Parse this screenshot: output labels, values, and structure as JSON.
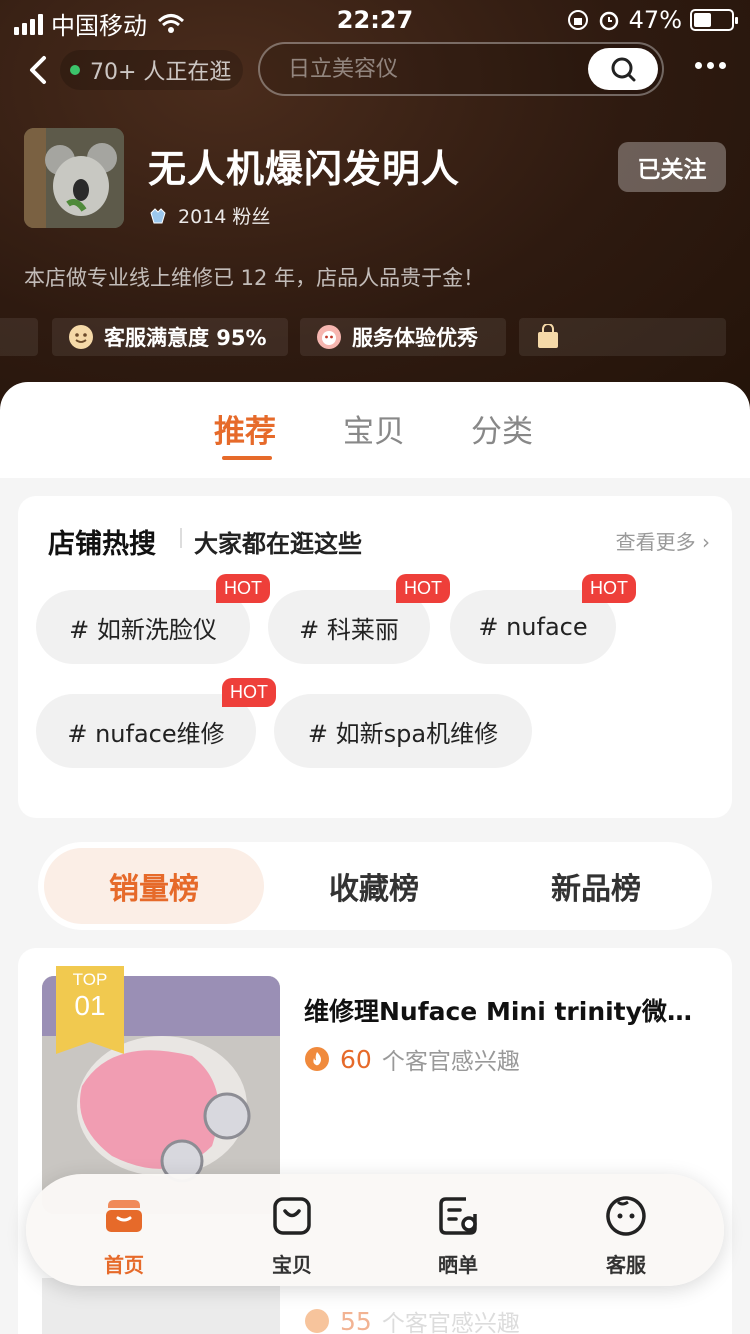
{
  "status_bar": {
    "carrier": "中国移动",
    "time": "22:27",
    "battery": "47%"
  },
  "header": {
    "visitors": "70+ 人正在逛",
    "search_placeholder": "日立美容仪"
  },
  "shop": {
    "name": "无人机爆闪发明人",
    "fans": "2014 粉丝",
    "follow_label": "已关注",
    "slogan": "本店做专业线上维修已 12 年，店品人品贵于金！",
    "badges": [
      {
        "icon": "smiley-icon",
        "label": "客服满意度 95%"
      },
      {
        "icon": "service-face-icon",
        "label": "服务体验优秀"
      }
    ]
  },
  "tabs": {
    "recommend": "推荐",
    "items": "宝贝",
    "category": "分类"
  },
  "hot_search": {
    "title": "店铺热搜",
    "subtitle": "大家都在逛这些",
    "see_more": "查看更多",
    "hot_label": "HOT",
    "chips": [
      {
        "label": "# 如新洗脸仪",
        "hot": true
      },
      {
        "label": "# 科莱丽",
        "hot": true
      },
      {
        "label": "# nuface",
        "hot": true
      },
      {
        "label": "# nuface维修",
        "hot": true
      },
      {
        "label": "# 如新spa机维修",
        "hot": false
      }
    ]
  },
  "rankings": {
    "sales": "销量榜",
    "favorites": "收藏榜",
    "new": "新品榜",
    "active": "sales"
  },
  "products": [
    {
      "rank_top": "TOP",
      "rank_num": "01",
      "title": "维修理Nuface Mini trinity微电流美容仪",
      "interest_count": "60",
      "interest_text": "个客官感兴趣"
    },
    {
      "interest_count": "55",
      "interest_text": "个客官感兴趣"
    }
  ],
  "tabbar": {
    "home": "首页",
    "items": "宝贝",
    "show": "晒单",
    "service": "客服"
  },
  "colors": {
    "accent": "#e66a2a",
    "hot": "#ee3f3a",
    "top_badge": "#f1c94f"
  }
}
